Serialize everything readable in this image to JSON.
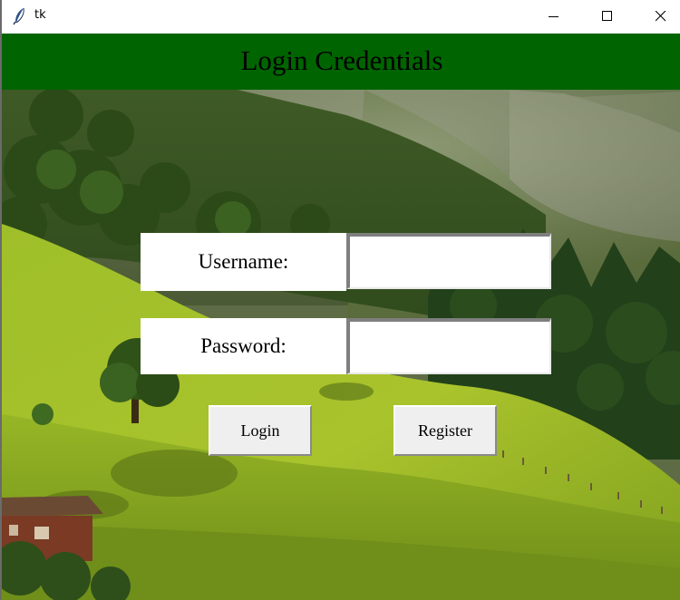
{
  "window": {
    "title": "tk",
    "icons": {
      "app": "feather-icon",
      "minimize": "minimize-icon",
      "maximize": "maximize-icon",
      "close": "close-icon"
    }
  },
  "header": {
    "title": "Login Credentials",
    "background": "#006400"
  },
  "form": {
    "username": {
      "label": "Username:",
      "value": ""
    },
    "password": {
      "label": "Password:",
      "value": ""
    }
  },
  "buttons": {
    "login": "Login",
    "register": "Register"
  },
  "colors": {
    "header_bg": "#006400",
    "button_bg": "#efefef",
    "label_bg": "#ffffff"
  }
}
